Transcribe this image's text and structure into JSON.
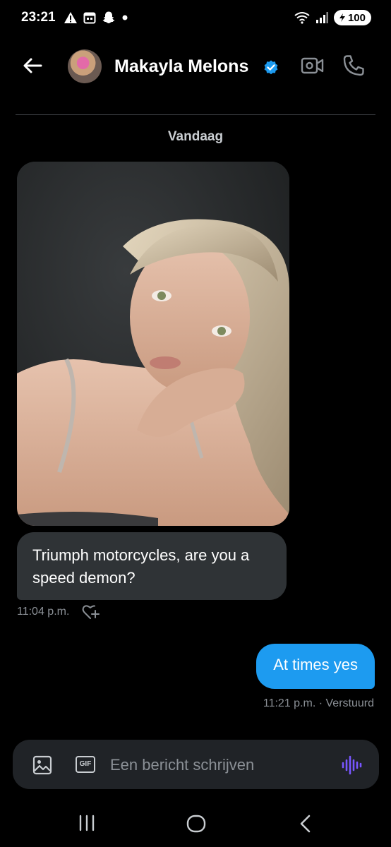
{
  "status_bar": {
    "time": "23:21",
    "battery": "100",
    "icons_left": [
      "alert-icon",
      "calendar-icon",
      "snapchat-icon",
      "dot-icon"
    ],
    "icons_right": [
      "wifi-icon",
      "signal-icon",
      "battery-icon"
    ]
  },
  "header": {
    "display_name": "Makayla Melons",
    "verified": true,
    "icons": [
      "back-arrow-icon",
      "verified-badge-icon",
      "video-call-icon",
      "phone-icon"
    ]
  },
  "conversation": {
    "date_label": "Vandaag",
    "messages": [
      {
        "type": "image",
        "direction": "incoming"
      },
      {
        "type": "text",
        "direction": "incoming",
        "text": "Triumph motorcycles, are you a speed demon?",
        "timestamp": "11:04 p.m."
      },
      {
        "type": "text",
        "direction": "outgoing",
        "text": "At times yes",
        "timestamp": "11:21 p.m. · Verstuurd"
      }
    ]
  },
  "composer": {
    "placeholder": "Een bericht schrijven",
    "gif_label": "GIF",
    "icons": [
      "image-icon",
      "gif-icon",
      "voice-icon"
    ]
  },
  "nav_bar": {
    "icons": [
      "recents-icon",
      "home-icon",
      "back-icon"
    ]
  },
  "colors": {
    "background": "#000000",
    "incoming_bubble": "#2f3336",
    "outgoing_bubble": "#1d9bf0",
    "composer": "#202327",
    "voice_accent": "#7856ff",
    "verified": "#1d9bf0"
  }
}
